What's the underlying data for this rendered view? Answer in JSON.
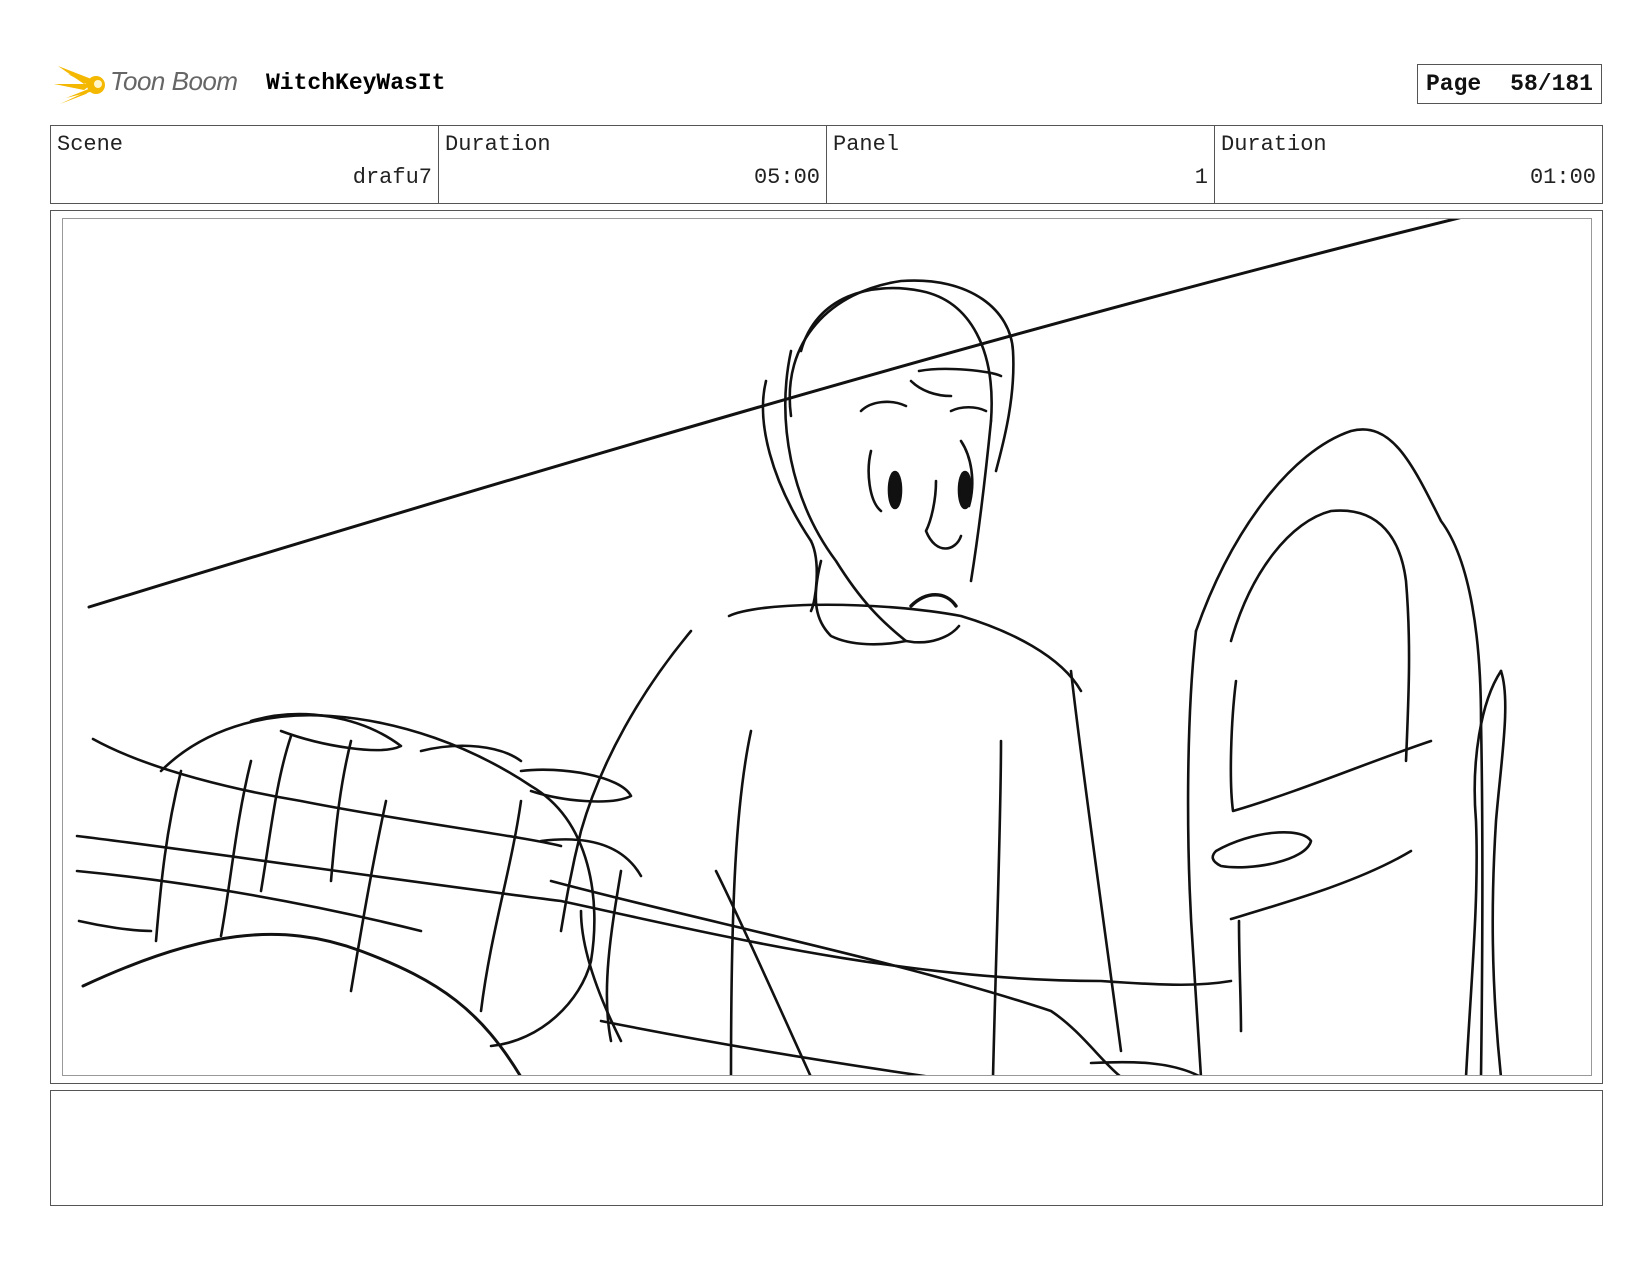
{
  "header": {
    "logo_text": "Toon Boom",
    "project_title": "WitchKeyWasIt",
    "page_label": "Page",
    "page_number": "58/181",
    "logo_color": "#f5b800"
  },
  "info": {
    "scene_label": "Scene",
    "scene_value": "drafu7",
    "scene_duration_label": "Duration",
    "scene_duration_value": "05:00",
    "panel_label": "Panel",
    "panel_value": "1",
    "panel_duration_label": "Duration",
    "panel_duration_value": "01:00"
  },
  "caption": {
    "text": ""
  }
}
